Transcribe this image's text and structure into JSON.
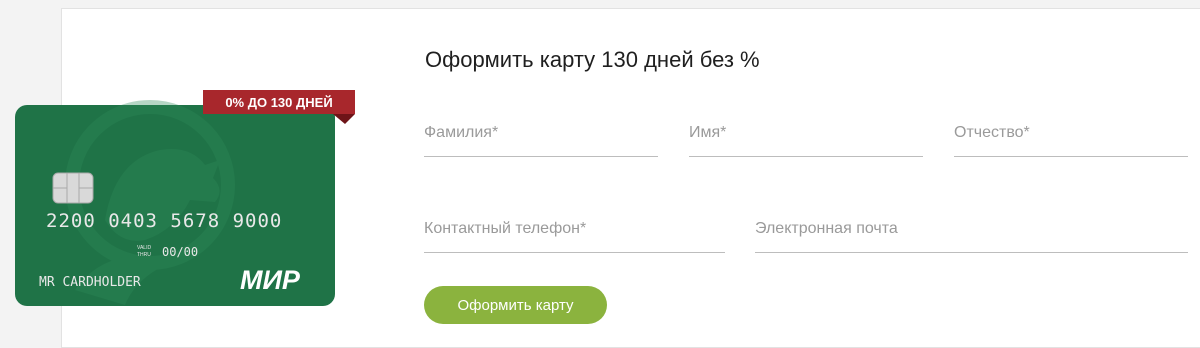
{
  "card": {
    "badge": "0% ДО 130 ДНЕЙ",
    "number": "2200 0403 5678 9000",
    "valid_label_top": "VALID",
    "valid_label_bottom": "THRU",
    "valid_date": "00/00",
    "holder": "MR CARDHOLDER",
    "brand": "МИР",
    "colors": {
      "card": "#1f7347",
      "badge": "#a8272c"
    }
  },
  "form": {
    "title": "Оформить карту 130 дней без %",
    "fields": {
      "lastname": {
        "placeholder": "Фамилия*",
        "value": ""
      },
      "firstname": {
        "placeholder": "Имя*",
        "value": ""
      },
      "middlename": {
        "placeholder": "Отчество*",
        "value": ""
      },
      "phone": {
        "placeholder": "Контактный телефон*",
        "value": ""
      },
      "email": {
        "placeholder": "Электронная почта",
        "value": ""
      }
    },
    "submit_label": "Оформить карту",
    "accent_color": "#8bb33e"
  }
}
